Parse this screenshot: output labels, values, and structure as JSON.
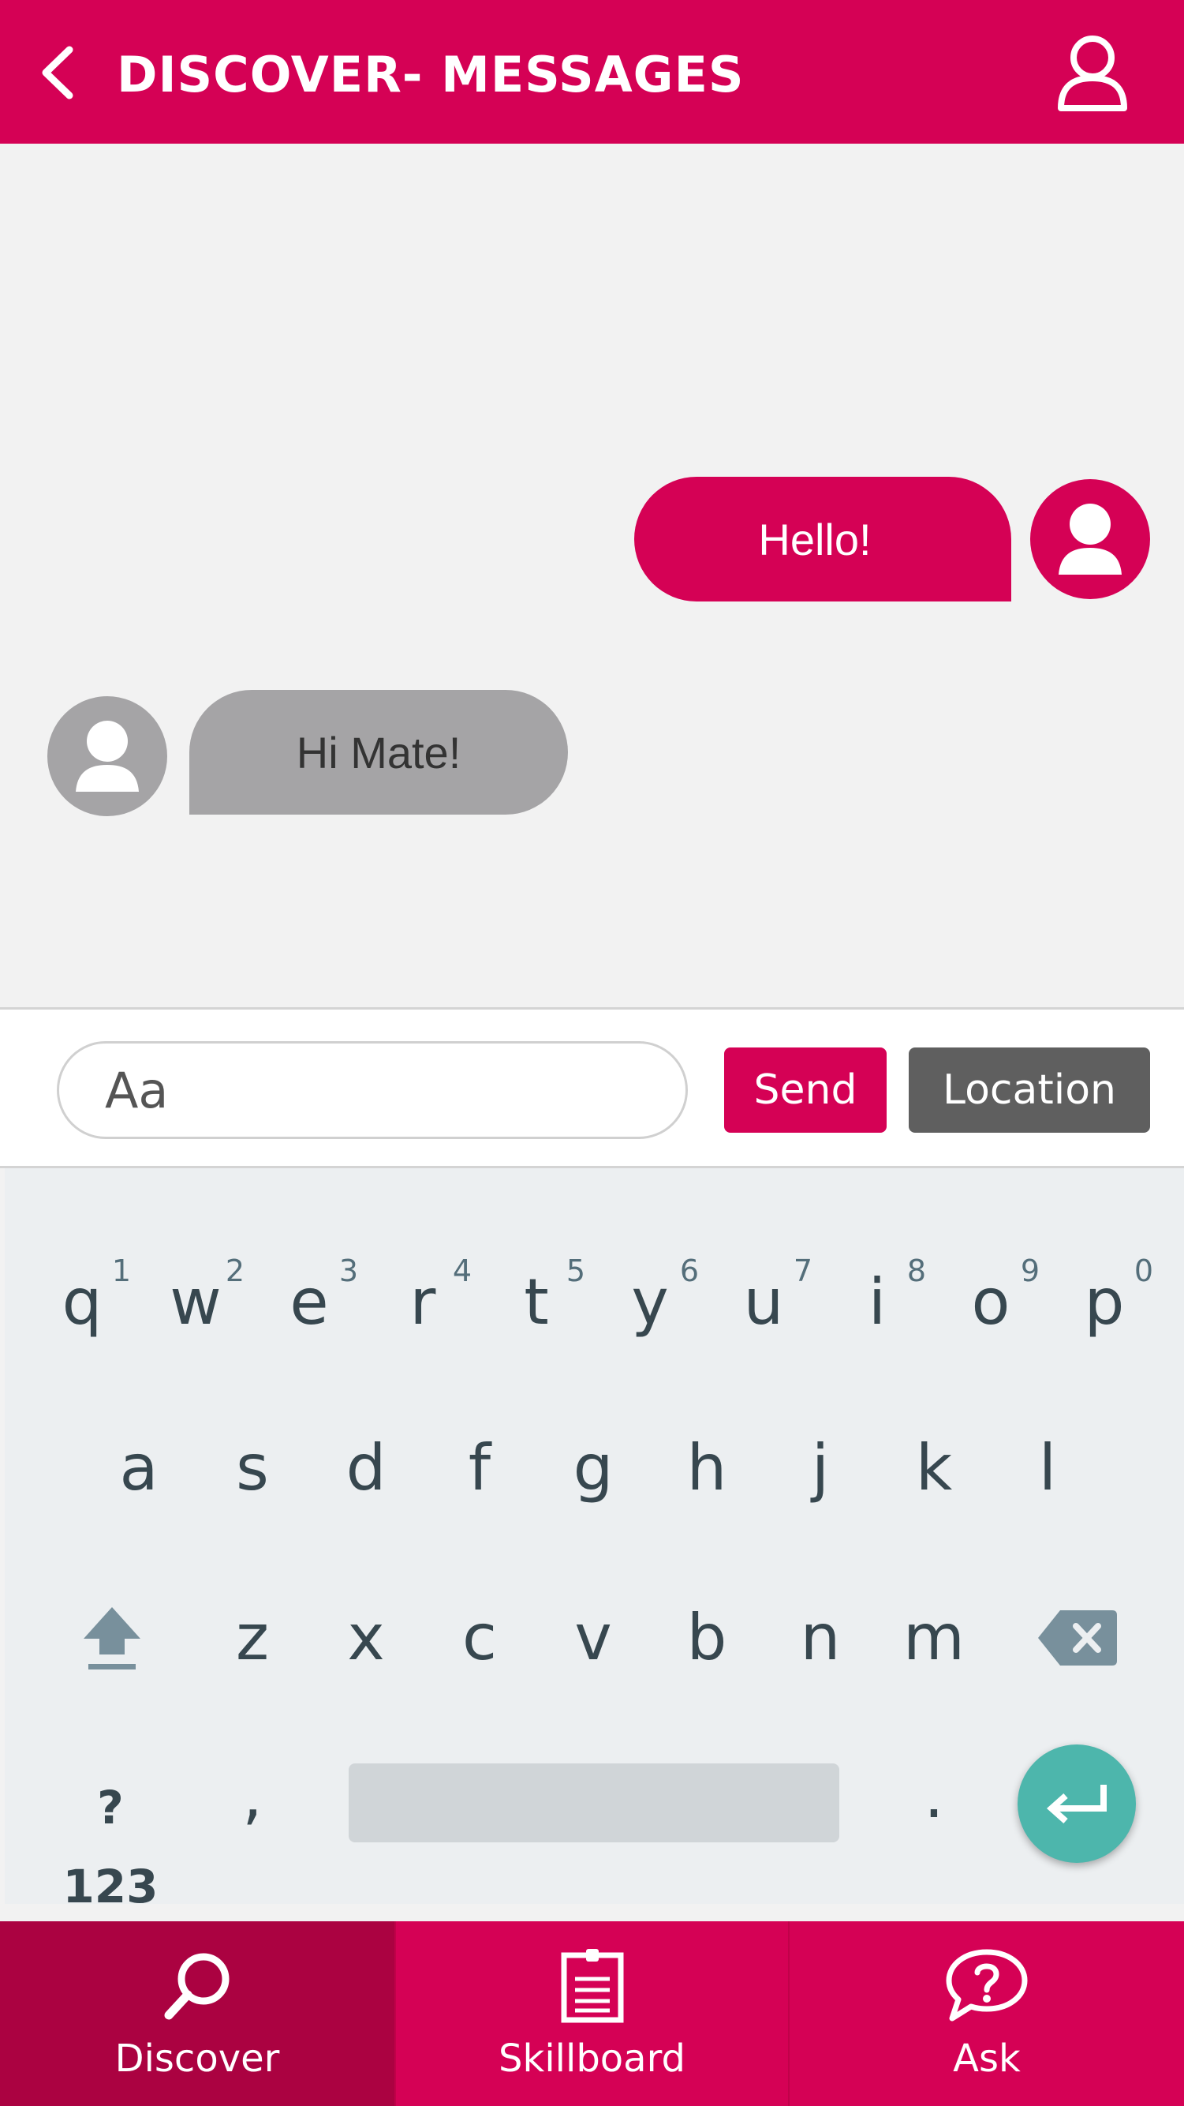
{
  "colors": {
    "brand": "#d50155",
    "brand_dark": "#ab0241",
    "incoming_bubble": "#a5a4a6",
    "location_button": "#5f5f5f",
    "enter_key": "#4db6ac"
  },
  "header": {
    "title": "DISCOVER- MESSAGES",
    "back_icon": "chevron-left-icon",
    "profile_icon": "user-icon"
  },
  "messages": [
    {
      "direction": "outgoing",
      "text": "Hello!"
    },
    {
      "direction": "incoming",
      "text": "Hi Mate!"
    }
  ],
  "compose": {
    "placeholder": "Aa",
    "send_label": "Send",
    "location_label": "Location"
  },
  "keyboard": {
    "row1": [
      {
        "key": "q",
        "hint": "1"
      },
      {
        "key": "w",
        "hint": "2"
      },
      {
        "key": "e",
        "hint": "3"
      },
      {
        "key": "r",
        "hint": "4"
      },
      {
        "key": "t",
        "hint": "5"
      },
      {
        "key": "y",
        "hint": "6"
      },
      {
        "key": "u",
        "hint": "7"
      },
      {
        "key": "i",
        "hint": "8"
      },
      {
        "key": "o",
        "hint": "9"
      },
      {
        "key": "p",
        "hint": "0"
      }
    ],
    "row2": [
      "a",
      "s",
      "d",
      "f",
      "g",
      "h",
      "j",
      "k",
      "l"
    ],
    "row3": [
      "z",
      "x",
      "c",
      "v",
      "b",
      "n",
      "m"
    ],
    "symbols_label": "?123",
    "comma": ",",
    "period": "."
  },
  "nav": [
    {
      "label": "Discover",
      "icon": "search-icon",
      "active": true
    },
    {
      "label": "Skillboard",
      "icon": "clipboard-icon",
      "active": false
    },
    {
      "label": "Ask",
      "icon": "question-bubble-icon",
      "active": false
    }
  ]
}
